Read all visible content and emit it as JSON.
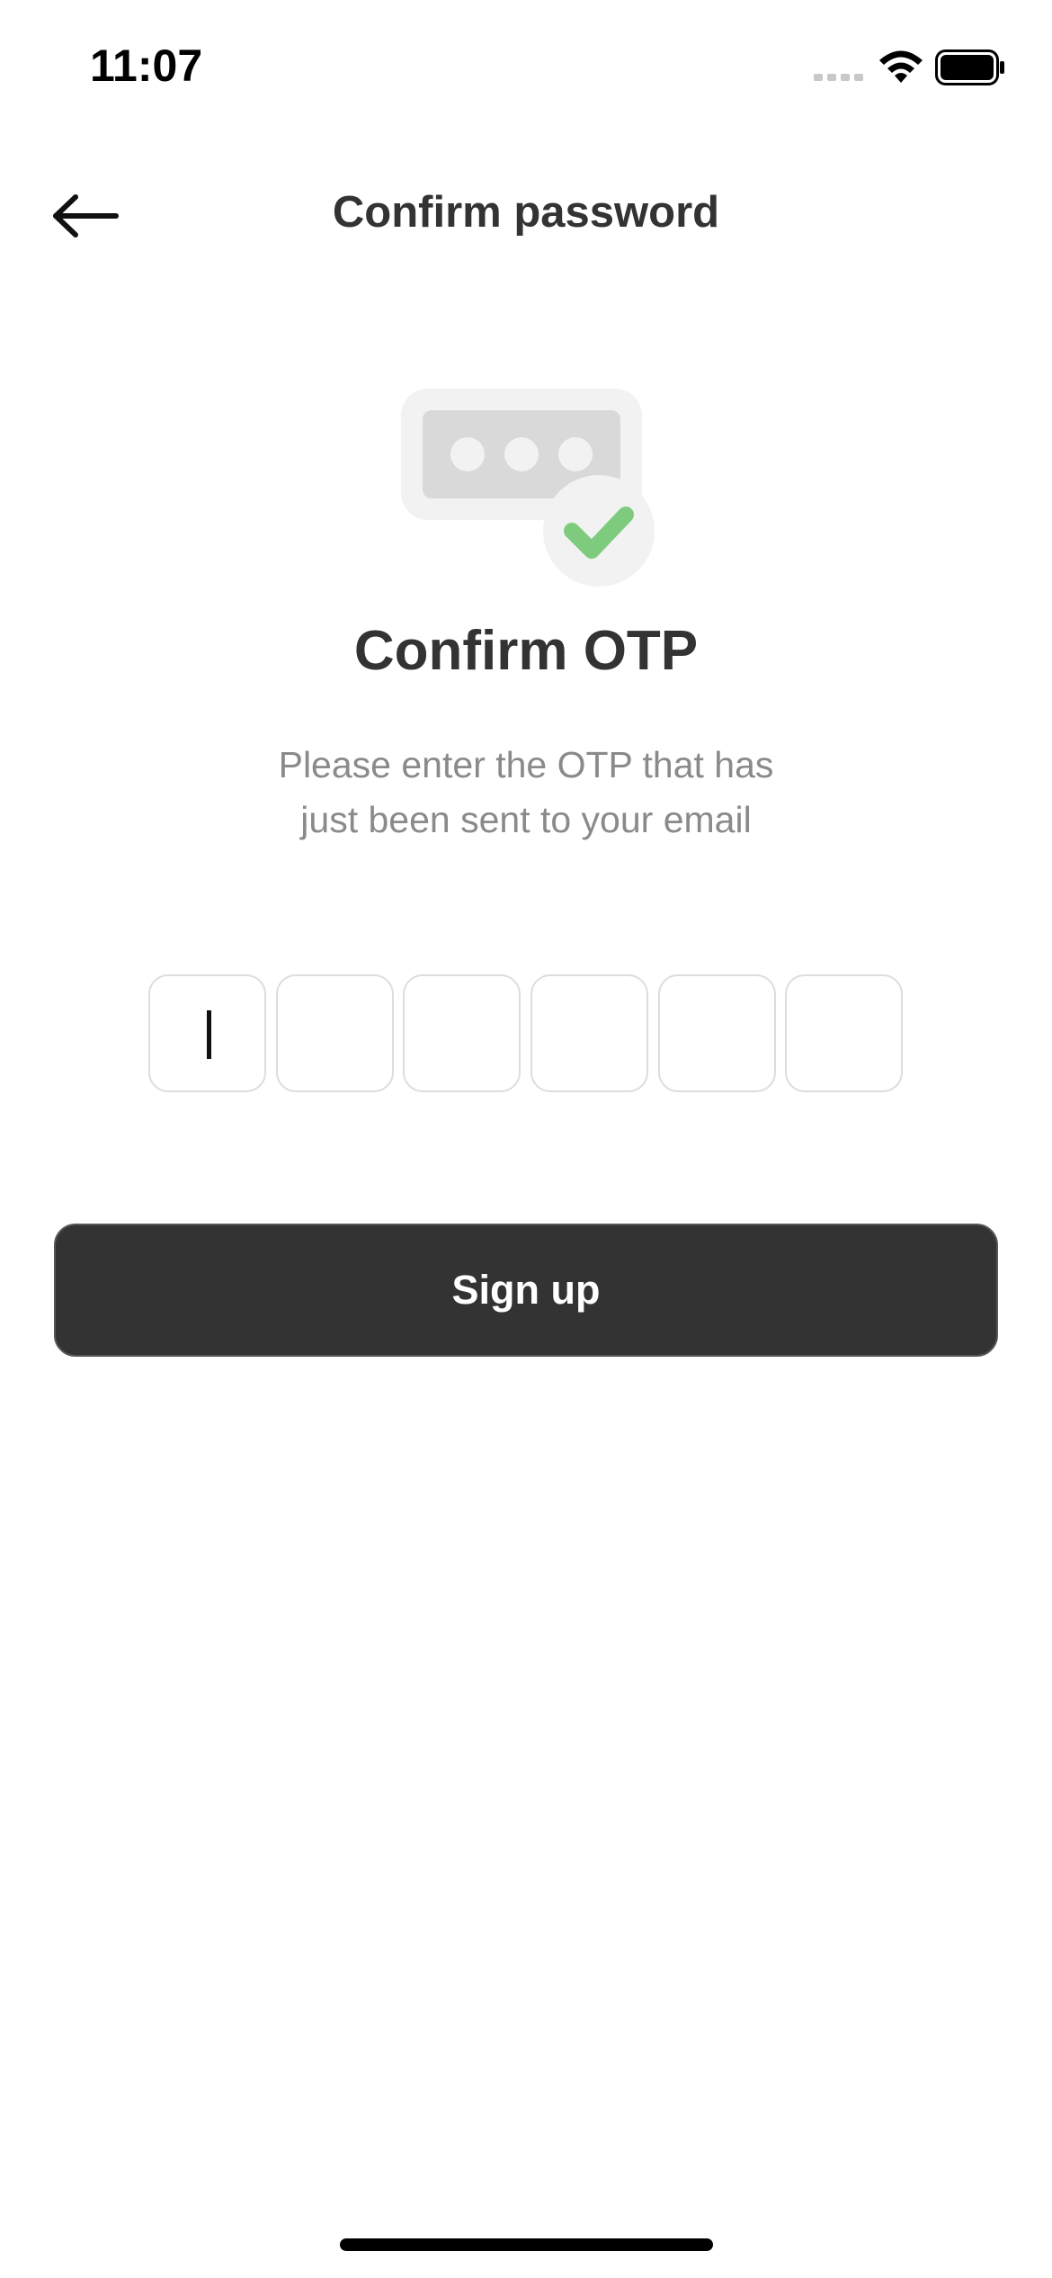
{
  "status_bar": {
    "time": "11:07",
    "signal_icon": "cellular-signal-icon",
    "wifi_icon": "wifi-icon",
    "battery_icon": "battery-icon"
  },
  "header": {
    "back_icon": "arrow-left-icon",
    "title": "Confirm password"
  },
  "illustration": {
    "icon": "password-confirmed-icon",
    "accent_color": "#7ecb7e"
  },
  "main": {
    "heading": "Confirm OTP",
    "subtitle_line1": "Please enter the OTP that has",
    "subtitle_line2": "just been sent to your email"
  },
  "otp": {
    "digits": [
      "",
      "",
      "",
      "",
      "",
      ""
    ],
    "focused_index": 0
  },
  "actions": {
    "signup_label": "Sign up"
  },
  "colors": {
    "primary_dark": "#333333",
    "muted_text": "#8a8a8a",
    "input_border": "#dddddd"
  }
}
